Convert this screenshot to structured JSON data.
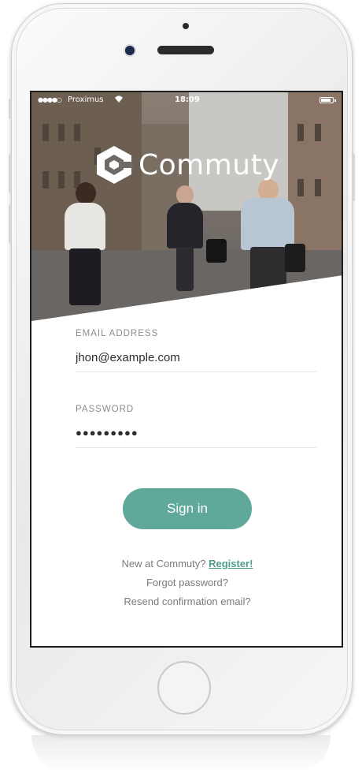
{
  "status_bar": {
    "signal": "●●●●○",
    "carrier": "Proximus",
    "wifi_icon": "wifi-icon",
    "time": "18:09",
    "battery_icon": "battery-icon"
  },
  "brand": {
    "name": "Commuty",
    "logo_icon": "hexagon-c-logo-icon"
  },
  "form": {
    "email_label": "EMAIL ADDRESS",
    "email_value": "jhon@example.com",
    "password_label": "PASSWORD",
    "password_value": "●●●●●●●●●"
  },
  "actions": {
    "signin_label": "Sign in"
  },
  "links": {
    "new_prefix": "New at Commuty?",
    "register": "Register!",
    "forgot": "Forgot password?",
    "resend": "Resend confirmation email?"
  },
  "colors": {
    "accent": "#5fa89a",
    "link": "#4e9c8e",
    "label": "#8c8c8c"
  }
}
